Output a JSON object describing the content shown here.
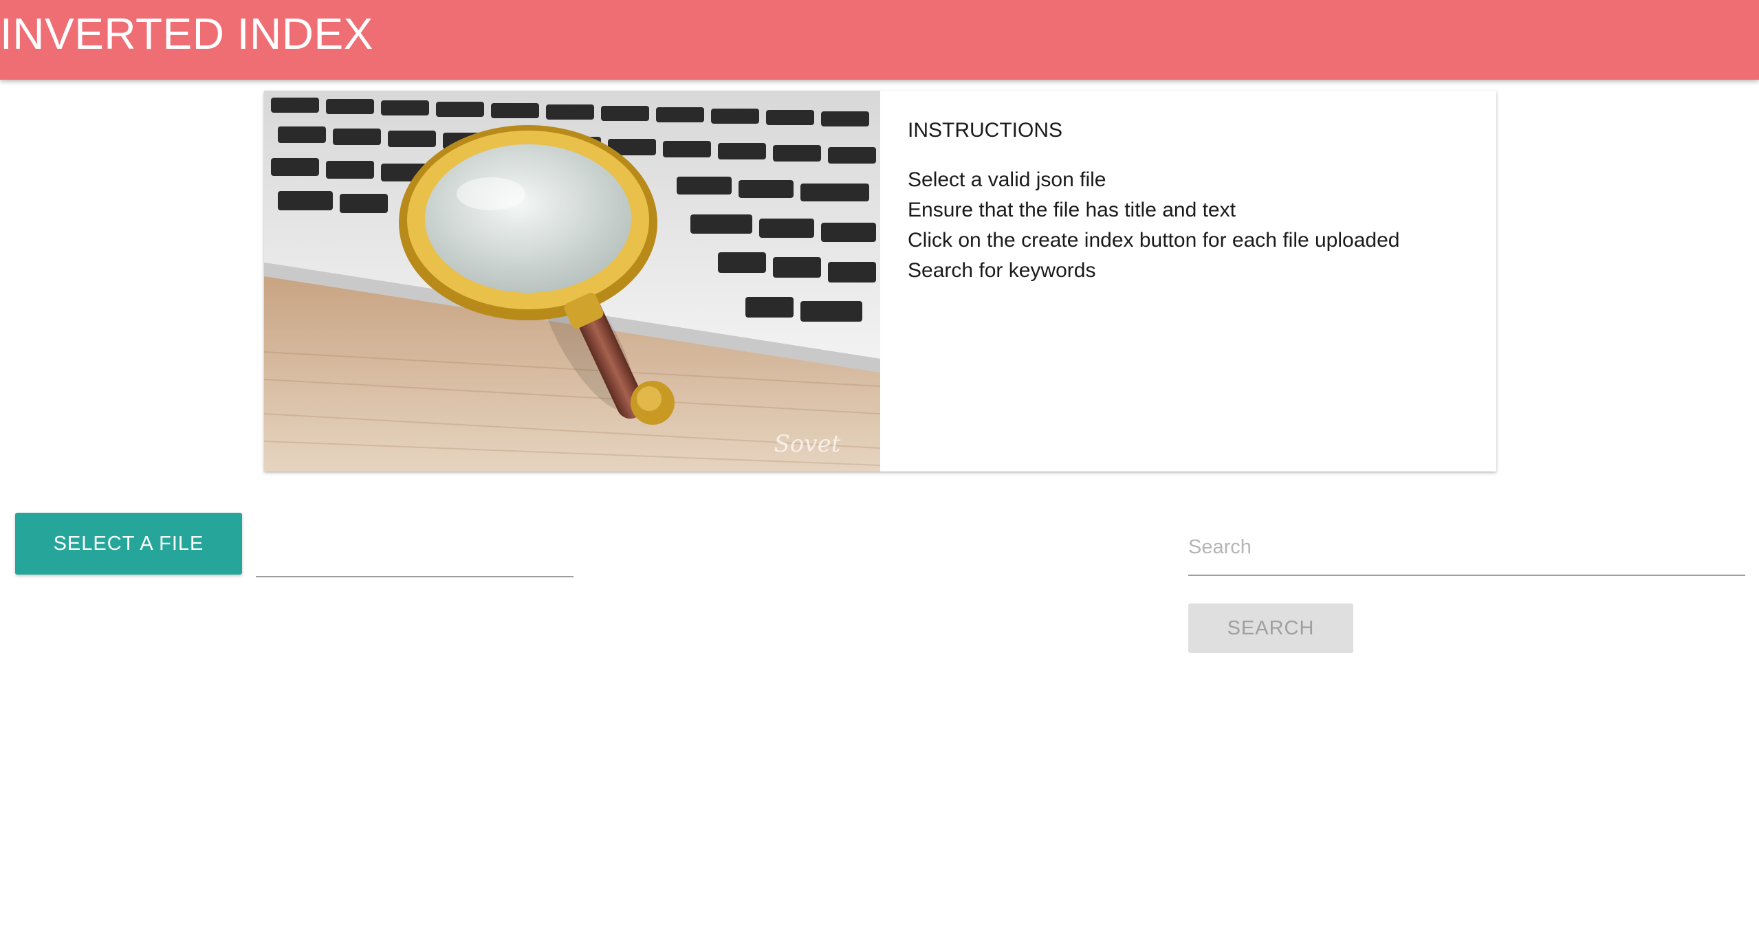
{
  "header": {
    "title": "INVERTED INDEX",
    "background_color": "#ef6e74"
  },
  "instructions_card": {
    "image_description_icon": "magnifying-glass-on-keyboard-image",
    "watermark_text": "Sovet",
    "heading": "INSTRUCTIONS",
    "lines": [
      "Select a valid json file",
      "Ensure that the file has title and text",
      "Click on the create index button for each file uploaded",
      "Search for keywords"
    ]
  },
  "upload": {
    "select_button_label": "SELECT A FILE",
    "select_button_color": "#26a69a",
    "file_path_value": ""
  },
  "search": {
    "placeholder": "Search",
    "value": "",
    "button_label": "SEARCH",
    "button_disabled": true
  }
}
